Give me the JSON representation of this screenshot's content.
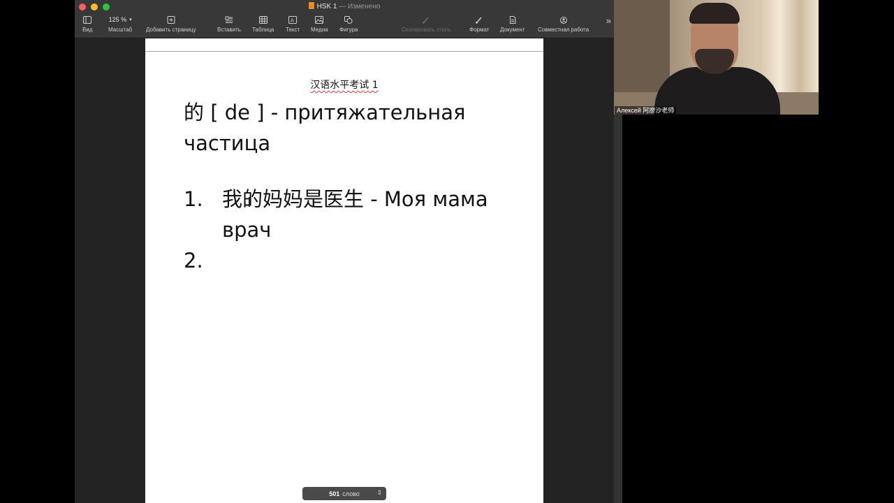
{
  "window": {
    "title": "HSK 1",
    "title_separator": "—",
    "status": "Изменено"
  },
  "toolbar": {
    "view_label": "Вид",
    "zoom_value": "125 %",
    "zoom_label": "Масштаб",
    "add_page_label": "Добавить страницу",
    "insert_label": "Вставить",
    "table_label": "Таблица",
    "text_label": "Текст",
    "media_label": "Медиа",
    "shape_label": "Фигура",
    "copy_style_label": "Скопировать стиль",
    "format_label": "Формат",
    "document_label": "Документ",
    "collaborate_label": "Совместная работа"
  },
  "document": {
    "header": "汉语水平考试 1",
    "heading": "的 [ de ] - притяжательная частица",
    "list": [
      {
        "number": "1.",
        "text": "我的妈妈是医生 - Моя мама врач"
      },
      {
        "number": "2.",
        "text": ""
      }
    ]
  },
  "word_count": {
    "count": "501",
    "unit": "слово"
  },
  "video": {
    "participant_name": "Алексей 阿廖沙老师"
  },
  "colors": {
    "toolbar_bg": "#383838",
    "window_bg": "#232323",
    "page_bg": "#ffffff",
    "close": "#fe5f57",
    "minimize": "#febc2e",
    "maximize": "#28c840",
    "doc_icon": "#f08a24"
  }
}
